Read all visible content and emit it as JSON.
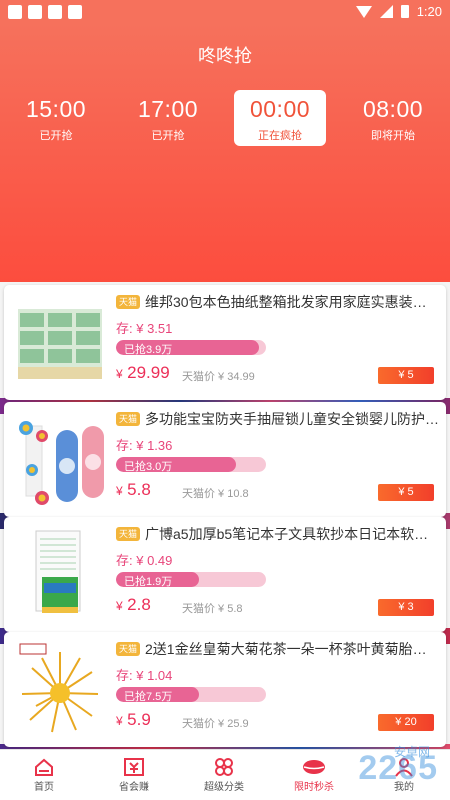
{
  "status": {
    "time": "1:20"
  },
  "header": {
    "title": "咚咚抢"
  },
  "timeslots": [
    {
      "time": "15:00",
      "status": "已开抢",
      "active": false
    },
    {
      "time": "17:00",
      "status": "已开抢",
      "active": false
    },
    {
      "time": "00:00",
      "status": "正在疯抢",
      "active": true
    },
    {
      "time": "08:00",
      "status": "即将开始",
      "active": false
    }
  ],
  "products": [
    {
      "tag": "天猫",
      "name": "维邦30包本色抽纸整箱批发家用家庭实惠装卫生…",
      "stock": "存: ¥ 3.51",
      "sold_label": "已抢3.9万",
      "sold_fraction": 0.95,
      "currency": "¥",
      "price": "29.99",
      "tmall_price": "天猫价 ¥ 34.99",
      "coupon": "¥ 5"
    },
    {
      "tag": "天猫",
      "name": "多功能宝宝防夹手抽屉锁儿童安全锁婴儿防护开…",
      "stock": "存: ¥ 1.36",
      "sold_label": "已抢3.0万",
      "sold_fraction": 0.8,
      "currency": "¥",
      "price": "5.8",
      "tmall_price": "天猫价 ¥ 10.8",
      "coupon": "¥ 5"
    },
    {
      "tag": "天猫",
      "name": "广博a5加厚b5笔记本子文具软抄本日记本软面…",
      "stock": "存: ¥ 0.49",
      "sold_label": "已抢1.9万",
      "sold_fraction": 0.55,
      "currency": "¥",
      "price": "2.8",
      "tmall_price": "天猫价 ¥ 5.8",
      "coupon": "¥ 3"
    },
    {
      "tag": "天猫",
      "name": "2送1金丝皇菊大菊花茶一朵一杯茶叶黄菊胎菊贡…",
      "stock": "存: ¥ 1.04",
      "sold_label": "已抢7.5万",
      "sold_fraction": 0.55,
      "currency": "¥",
      "price": "5.9",
      "tmall_price": "天猫价 ¥ 25.9",
      "coupon": "¥ 20"
    }
  ],
  "tabs": [
    {
      "label": "首页",
      "icon": "home-icon",
      "active": false
    },
    {
      "label": "省会赚",
      "icon": "rebate-icon",
      "active": false
    },
    {
      "label": "超级分类",
      "icon": "clover-icon",
      "active": false
    },
    {
      "label": "限时秒杀",
      "icon": "lips-icon",
      "active": true
    },
    {
      "label": "我的",
      "icon": "user-icon",
      "active": false
    }
  ],
  "watermark": {
    "brand": "2265",
    "sub": "安卓网"
  },
  "colors": {
    "accent": "#f0533a",
    "price": "#ec2f58",
    "progress": "#e86494"
  }
}
